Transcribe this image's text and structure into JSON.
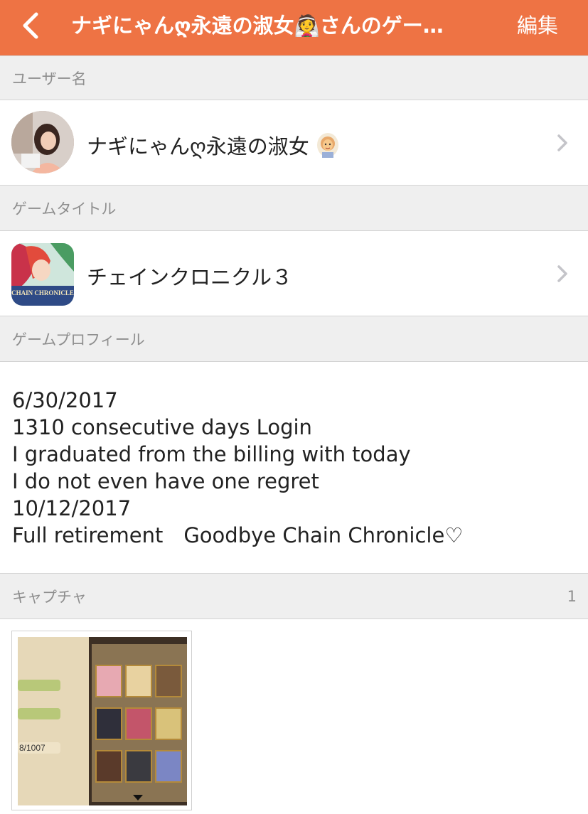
{
  "navbar": {
    "title": "ナギにゃんღ永遠の淑女👰さんのゲー…",
    "edit_label": "編集",
    "bg_color": "#ee7344"
  },
  "sections": {
    "username_header": "ユーザー名",
    "game_title_header": "ゲームタイトル",
    "game_profile_header": "ゲームプロフィール",
    "capture_header": "キャプチャ",
    "capture_count": "1"
  },
  "user": {
    "name": "ナギにゃんღ永遠の淑女",
    "avatar_icon": "user-avatar-photo"
  },
  "game": {
    "title": "チェインクロニクル３",
    "icon": "chain-chronicle-app-icon",
    "icon_text": "CHAIN CHRONICLE"
  },
  "profile": {
    "text": "6/30/2017\n1310 consecutive days Login\nI graduated from the billing with today\nI do not even have one regret\n10/12/2017\nFull retirement　Goodbye Chain Chronicle♡"
  },
  "capture": {
    "thumbnail_icon": "game-screenshot-thumbnail",
    "counter_text": "8/1007"
  }
}
